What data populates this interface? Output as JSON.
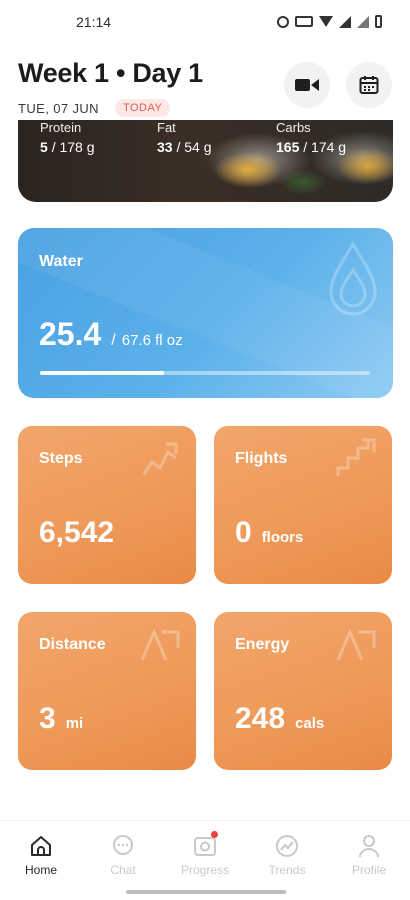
{
  "status_bar": {
    "time": "21:14"
  },
  "header": {
    "title": "Week 1 • Day 1",
    "date": "TUE, 07 JUN",
    "today_badge": "TODAY",
    "video_icon": "video-camera-icon",
    "calendar_icon": "calendar-icon"
  },
  "macros": [
    {
      "label": "Protein",
      "current": "5",
      "goal": "/ 178 g"
    },
    {
      "label": "Fat",
      "current": "33",
      "goal": "/ 54 g"
    },
    {
      "label": "Carbs",
      "current": "165",
      "goal": "/ 174 g"
    }
  ],
  "water": {
    "title": "Water",
    "value": "25.4",
    "separator": "/",
    "goal": "67.6 fl oz",
    "progress_fraction": 0.376,
    "color": "#4aa1e2"
  },
  "stats": {
    "steps": {
      "title": "Steps",
      "value": "6,542",
      "unit": ""
    },
    "flights": {
      "title": "Flights",
      "value": "0",
      "unit": "floors"
    },
    "distance": {
      "title": "Distance",
      "value": "3",
      "unit": "mi"
    },
    "energy": {
      "title": "Energy",
      "value": "248",
      "unit": "cals"
    },
    "color": "#ee9a5a"
  },
  "nav": {
    "active": "Home",
    "items": [
      {
        "label": "Home",
        "icon": "home-icon"
      },
      {
        "label": "Chat",
        "icon": "chat-icon"
      },
      {
        "label": "Progress",
        "icon": "camera-icon"
      },
      {
        "label": "Trends",
        "icon": "trends-icon"
      },
      {
        "label": "Profile",
        "icon": "profile-icon"
      }
    ]
  }
}
